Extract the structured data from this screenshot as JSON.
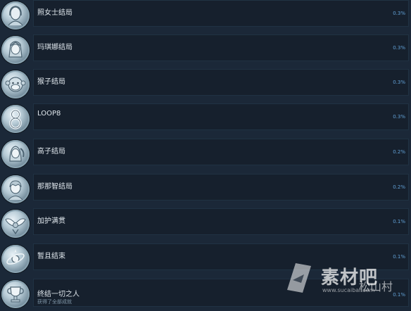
{
  "achievements": [
    {
      "title": "照女士结局",
      "percent": "0.3%",
      "icon": "woman-portrait-icon"
    },
    {
      "title": "玛琪娜结局",
      "percent": "0.3%",
      "icon": "girl-portrait-icon"
    },
    {
      "title": "猴子结局",
      "percent": "0.3%",
      "icon": "monkey-face-icon"
    },
    {
      "title": "LOOP8",
      "percent": "0.3%",
      "icon": "number-eight-icon"
    },
    {
      "title": "高子结局",
      "percent": "0.2%",
      "icon": "girl-ponytail-portrait-icon"
    },
    {
      "title": "那那智结局",
      "percent": "0.2%",
      "icon": "boy-portrait-icon"
    },
    {
      "title": "加护满贯",
      "percent": "0.1%",
      "icon": "wings-emblem-icon"
    },
    {
      "title": "暂且结束",
      "percent": "0.1%",
      "icon": "orbit-symbol-icon"
    },
    {
      "title": "终结一切之人",
      "subtitle": "获得了全部成就",
      "percent": "0.1%",
      "icon": "trophy-icon"
    }
  ],
  "watermark": {
    "brand": "素材吧",
    "url": "www.sucaibar.com",
    "signature": "松山村"
  },
  "colors": {
    "background": "#1b2838",
    "panel": "#16202d",
    "percent": "#61a0d5"
  }
}
